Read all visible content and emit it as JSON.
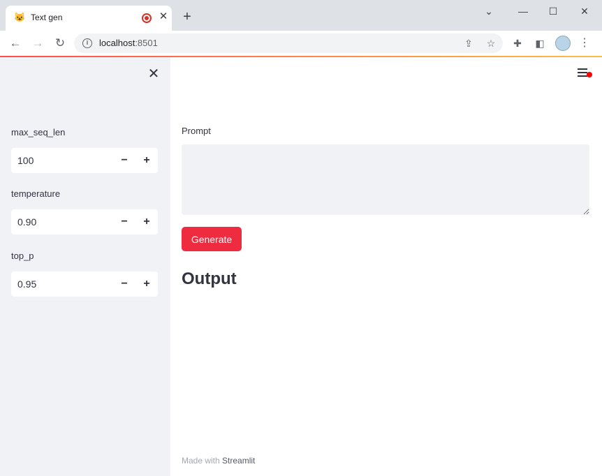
{
  "browser": {
    "tab_title": "Text gen",
    "tab_favicon": "😺",
    "tab_close": "✕",
    "new_tab": "+",
    "url_host": "localhost",
    "url_port": ":8501",
    "icons": {
      "back": "back-arrow-icon",
      "forward": "forward-arrow-icon",
      "reload": "reload-icon",
      "info": "info-icon",
      "share": "share-icon",
      "star": "star-icon",
      "extensions": "puzzle-icon",
      "side_panel": "side-panel-icon",
      "menu": "vertical-dots-icon"
    }
  },
  "sidebar": {
    "params": [
      {
        "label": "max_seq_len",
        "value": "100"
      },
      {
        "label": "temperature",
        "value": "0.90"
      },
      {
        "label": "top_p",
        "value": "0.95"
      }
    ],
    "minus": "−",
    "plus": "+"
  },
  "main": {
    "prompt_label": "Prompt",
    "prompt_value": "",
    "generate_label": "Generate",
    "output_heading": "Output",
    "footer_prefix": "Made with ",
    "footer_brand": "Streamlit"
  },
  "colors": {
    "accent": "#ef2c3f",
    "sidebar_bg": "#f0f2f6",
    "text": "#31333f"
  }
}
